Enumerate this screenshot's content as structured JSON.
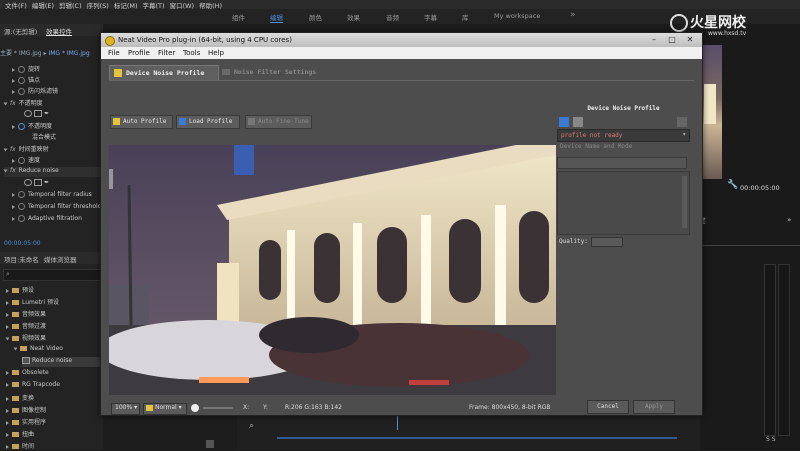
{
  "premiere": {
    "menu": [
      "文件(F)",
      "编辑(E)",
      "剪辑(C)",
      "序列(S)",
      "标记(M)",
      "字幕(T)",
      "窗口(W)",
      "帮助(H)"
    ],
    "workspaces": [
      "组件",
      "编辑",
      "颜色",
      "效果",
      "音频",
      "字幕",
      "库",
      "My workspace"
    ],
    "workspace_active": "编辑",
    "left_tabs": {
      "source": "源:(无剪辑)",
      "effect_controls": "效果控件"
    },
    "clip_path": "主要 * IMG.jpg",
    "clip_path2": "IMG * IMG.jpg",
    "effect_rows": [
      "旋转",
      "锚点",
      "防闪烁滤镜",
      "不透明度",
      "不透明度",
      "混合模式",
      "时间重映射",
      "速度",
      "Reduce noise",
      "Temporal filter radius",
      "Temporal filter threshold",
      "Adaptive filtration"
    ],
    "timecode_left": "00:00:05:00",
    "project_tabs": {
      "project": "项目:未命名",
      "media_browser": "媒体浏览器"
    },
    "folders": [
      "预设",
      "Lumetri 预设",
      "音频效果",
      "音频过渡",
      "视频效果",
      "Neat Video",
      "Reduce noise",
      "Obsolete",
      "RG Trapcode",
      "变换",
      "图像控制",
      "实用程序",
      "扭曲",
      "时间"
    ],
    "timecode_right": "00:00:05:00",
    "audio_label": "S S",
    "watermark": {
      "name": "火星网校",
      "url": "www.hxsd.tv"
    }
  },
  "neat": {
    "window_title": "Neat Video Pro plug-in (64-bit, using 4 CPU cores)",
    "menu": [
      "File",
      "Profile",
      "Filter",
      "Tools",
      "Help"
    ],
    "tabs": {
      "device_noise": "Device Noise Profile",
      "noise_filter": "Noise Filter Settings"
    },
    "toolbar": {
      "auto_profile": "Auto Profile",
      "load_profile": "Load Profile",
      "auto_fine_tune": "Auto Fine-Tune"
    },
    "right_panel": {
      "header": "Device Noise Profile",
      "status": "profile not ready",
      "name_placeholder": "Device Name and Mode",
      "quality_label": "Quality:"
    },
    "status_bar": {
      "zoom": "100%",
      "mode": "Normal",
      "coord_x": "X:",
      "coord_y": "Y:",
      "rgb": "R:206 G:163 B:142",
      "frame": "Frame: 800x450, 8-bit RGB"
    },
    "buttons": {
      "cancel": "Cancel",
      "apply": "Apply"
    },
    "colors": {
      "status_red": "#e07a7a",
      "accent_yellow": "#e6c43a"
    }
  }
}
